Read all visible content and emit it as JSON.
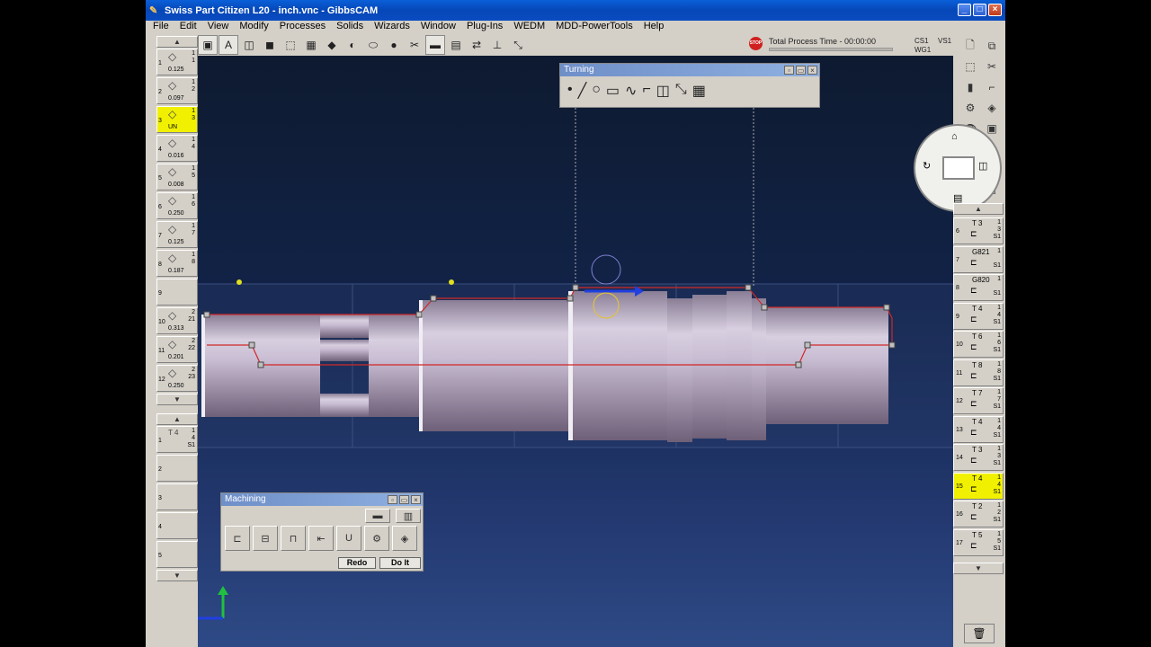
{
  "window": {
    "title": "Swiss Part Citizen L20 - inch.vnc - GibbsCAM"
  },
  "menu": [
    "File",
    "Edit",
    "View",
    "Modify",
    "Processes",
    "Solids",
    "Wizards",
    "Window",
    "Plug-Ins",
    "WEDM",
    "MDD-PowerTools",
    "Help"
  ],
  "status": {
    "process_time": "Total Process Time - 00:00:00",
    "cs": "CS1",
    "vs": "VS1",
    "wg": "WG1",
    "stop": "STOP"
  },
  "left_tools": [
    {
      "num": "1",
      "val": "0.125",
      "c1": "1",
      "c2": "1"
    },
    {
      "num": "2",
      "val": "0.097",
      "c1": "1",
      "c2": "2"
    },
    {
      "num": "3",
      "val": "UN",
      "c1": "1",
      "c2": "3",
      "selected": true
    },
    {
      "num": "4",
      "val": "0.016",
      "c1": "1",
      "c2": "4"
    },
    {
      "num": "5",
      "val": "0.008",
      "c1": "1",
      "c2": "5"
    },
    {
      "num": "6",
      "val": "0.250",
      "c1": "1",
      "c2": "6"
    },
    {
      "num": "7",
      "val": "0.125",
      "c1": "1",
      "c2": "7"
    },
    {
      "num": "8",
      "val": "0.187",
      "c1": "1",
      "c2": "8"
    },
    {
      "num": "9",
      "val": "",
      "c1": "",
      "c2": ""
    },
    {
      "num": "10",
      "val": "0.313",
      "c1": "2",
      "c2": "21"
    },
    {
      "num": "11",
      "val": "0.201",
      "c1": "2",
      "c2": "22"
    },
    {
      "num": "12",
      "val": "0.250",
      "c1": "2",
      "c2": "23"
    }
  ],
  "left_ops": [
    {
      "num": "1",
      "label": "T 4",
      "c1": "1",
      "c2": "4",
      "c3": "S1"
    },
    {
      "num": "2"
    },
    {
      "num": "3"
    },
    {
      "num": "4"
    },
    {
      "num": "5"
    }
  ],
  "right_ops": [
    {
      "num": "6",
      "t": "T 3",
      "c1": "1",
      "c2": "3",
      "c3": "S1"
    },
    {
      "num": "7",
      "t": "G821",
      "c1": "1",
      "c2": "",
      "c3": "S1"
    },
    {
      "num": "8",
      "t": "G820",
      "c1": "1",
      "c2": "",
      "c3": "S1"
    },
    {
      "num": "9",
      "t": "T 4",
      "c1": "1",
      "c2": "4",
      "c3": "S1"
    },
    {
      "num": "10",
      "t": "T 6",
      "c1": "1",
      "c2": "6",
      "c3": "S1"
    },
    {
      "num": "11",
      "t": "T 8",
      "c1": "1",
      "c2": "8",
      "c3": "S1"
    },
    {
      "num": "12",
      "t": "T 7",
      "c1": "1",
      "c2": "7",
      "c3": "S1"
    },
    {
      "num": "13",
      "t": "T 4",
      "c1": "1",
      "c2": "4",
      "c3": "S1"
    },
    {
      "num": "14",
      "t": "T 3",
      "c1": "1",
      "c2": "3",
      "c3": "S1"
    },
    {
      "num": "15",
      "t": "T 4",
      "c1": "1",
      "c2": "4",
      "c3": "S1",
      "selected": true
    },
    {
      "num": "16",
      "t": "T 2",
      "c1": "1",
      "c2": "2",
      "c3": "S1"
    },
    {
      "num": "17",
      "t": "T 5",
      "c1": "1",
      "c2": "5",
      "c3": "S1"
    }
  ],
  "turning_palette": {
    "title": "Turning"
  },
  "machining_palette": {
    "title": "Machining",
    "redo": "Redo",
    "doit": "Do It"
  }
}
